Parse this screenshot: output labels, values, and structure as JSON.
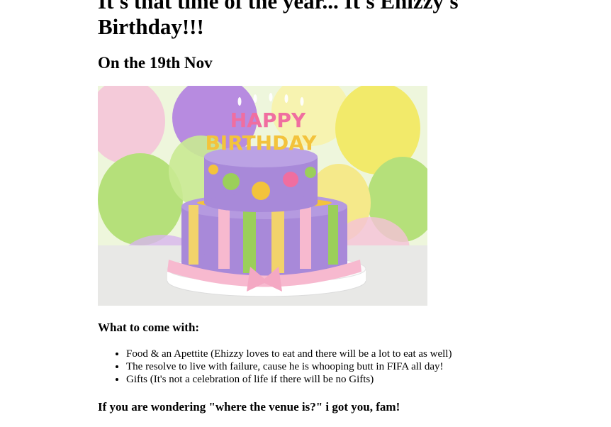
{
  "heading": {
    "title": "It's that time of the year... It's Ehizzy's Birthday!!!",
    "date": "On the 19th Nov"
  },
  "image": {
    "alt": "Happy Birthday cake",
    "cake_topper": {
      "line1": "HAPPY",
      "line2": "BIRTHDAY"
    },
    "colors": {
      "background": "#eaf3d8",
      "balloon_purple": "#b78be0",
      "balloon_green": "#b5e07a",
      "balloon_yellow": "#f2ea6a",
      "balloon_pink": "#f5c2d8",
      "cake_purple": "#a889d9",
      "cake_pink": "#f7b9cf",
      "dot_green": "#9bcf5a",
      "dot_pink": "#f06ea0",
      "dot_yellow": "#f3c33c",
      "stripe_yellow": "#f2d36b",
      "board": "#ffffff"
    }
  },
  "bring": {
    "heading": "What to come with:",
    "items": [
      "Food & an Apettite (Ehizzy loves to eat and there will be a lot to eat as well)",
      "The resolve to live with failure, cause he is whooping butt in FIFA all day!",
      "Gifts (It's not a celebration of life if there will be no Gifts)"
    ]
  },
  "venue": {
    "heading": "If you are wondering \"where the venue is?\" i got you, fam!"
  }
}
